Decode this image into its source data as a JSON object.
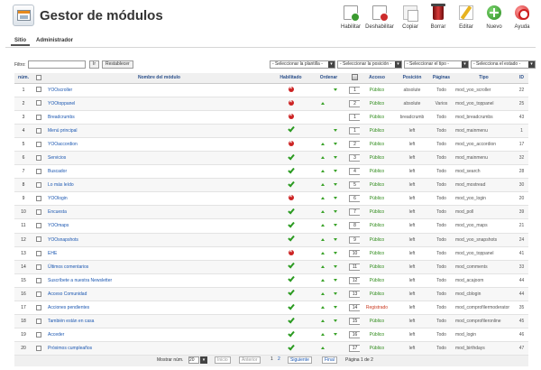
{
  "header": {
    "title": "Gestor de módulos"
  },
  "toolbar": [
    {
      "label": "Habilitar",
      "icon": "enable-icon"
    },
    {
      "label": "Deshabilitar",
      "icon": "disable-icon"
    },
    {
      "label": "Copiar",
      "icon": "copy-icon"
    },
    {
      "label": "Borrar",
      "icon": "trash-icon"
    },
    {
      "label": "Editar",
      "icon": "edit-icon"
    },
    {
      "label": "Nuevo",
      "icon": "new-icon"
    },
    {
      "label": "Ayuda",
      "icon": "help-icon"
    }
  ],
  "submenu": {
    "site": "Sitio",
    "admin": "Administrador"
  },
  "filter": {
    "label": "Filtro:",
    "value": "",
    "go": "Ir",
    "reset": "Restablecer",
    "template": "- Seleccionar la plantilla -",
    "position": "- Seleccionar la posición -",
    "type": "- Seleccionar el tipo -",
    "state": "- Selecciona el estado -"
  },
  "columns": {
    "num": "núm.",
    "name": "Nombre del módulo",
    "enabled": "Habilitado",
    "order": "Ordenar",
    "access": "Acceso",
    "position": "Posición",
    "pages": "Páginas",
    "type": "Tipo",
    "id": "ID"
  },
  "rows": [
    {
      "num": "1",
      "name": "YOOscroller",
      "enabled": false,
      "up": false,
      "down": true,
      "order": "1",
      "access": "Público",
      "position": "absolute",
      "pages": "Todo",
      "type": "mod_yoo_scroller",
      "id": "22"
    },
    {
      "num": "2",
      "name": "YOOtoppanel",
      "enabled": false,
      "up": true,
      "down": false,
      "order": "2",
      "access": "Público",
      "position": "absolute",
      "pages": "Varios",
      "type": "mod_yoo_toppanel",
      "id": "25"
    },
    {
      "num": "3",
      "name": "Breadcrumbs",
      "enabled": false,
      "up": false,
      "down": false,
      "order": "1",
      "access": "Público",
      "position": "breadcrumb",
      "pages": "Todo",
      "type": "mod_breadcrumbs",
      "id": "43"
    },
    {
      "num": "4",
      "name": "Menú principal",
      "enabled": true,
      "up": false,
      "down": true,
      "order": "1",
      "access": "Público",
      "position": "left",
      "pages": "Todo",
      "type": "mod_mainmenu",
      "id": "1"
    },
    {
      "num": "5",
      "name": "YOOaccordion",
      "enabled": false,
      "up": true,
      "down": true,
      "order": "2",
      "access": "Público",
      "position": "left",
      "pages": "Todo",
      "type": "mod_yoo_accordion",
      "id": "17"
    },
    {
      "num": "6",
      "name": "Servicios",
      "enabled": true,
      "up": true,
      "down": true,
      "order": "3",
      "access": "Público",
      "position": "left",
      "pages": "Todo",
      "type": "mod_mainmenu",
      "id": "32"
    },
    {
      "num": "7",
      "name": "Buscador",
      "enabled": true,
      "up": true,
      "down": true,
      "order": "4",
      "access": "Público",
      "position": "left",
      "pages": "Todo",
      "type": "mod_search",
      "id": "28"
    },
    {
      "num": "8",
      "name": "Lo más leído",
      "enabled": true,
      "up": true,
      "down": true,
      "order": "5",
      "access": "Público",
      "position": "left",
      "pages": "Todo",
      "type": "mod_mostread",
      "id": "30"
    },
    {
      "num": "9",
      "name": "YOOlogin",
      "enabled": false,
      "up": true,
      "down": true,
      "order": "6",
      "access": "Público",
      "position": "left",
      "pages": "Todo",
      "type": "mod_yoo_login",
      "id": "20"
    },
    {
      "num": "10",
      "name": "Encuesta",
      "enabled": true,
      "up": true,
      "down": true,
      "order": "7",
      "access": "Público",
      "position": "left",
      "pages": "Todo",
      "type": "mod_poll",
      "id": "39"
    },
    {
      "num": "11",
      "name": "YOOmaps",
      "enabled": true,
      "up": true,
      "down": true,
      "order": "8",
      "access": "Público",
      "position": "left",
      "pages": "Todo",
      "type": "mod_yoo_maps",
      "id": "21"
    },
    {
      "num": "12",
      "name": "YOOsnapshots",
      "enabled": true,
      "up": true,
      "down": true,
      "order": "9",
      "access": "Público",
      "position": "left",
      "pages": "Todo",
      "type": "mod_yoo_snapshots",
      "id": "24"
    },
    {
      "num": "13",
      "name": "EHE",
      "enabled": false,
      "up": true,
      "down": true,
      "order": "10",
      "access": "Público",
      "position": "left",
      "pages": "Todo",
      "type": "mod_yoo_toppanel",
      "id": "41"
    },
    {
      "num": "14",
      "name": "Últimos comentarios",
      "enabled": true,
      "up": true,
      "down": true,
      "order": "11",
      "access": "Público",
      "position": "left",
      "pages": "Todo",
      "type": "mod_comments",
      "id": "33"
    },
    {
      "num": "15",
      "name": "Suscríbete a nuestra Newsletter",
      "enabled": true,
      "up": true,
      "down": true,
      "order": "12",
      "access": "Público",
      "position": "left",
      "pages": "Todo",
      "type": "mod_acajoom",
      "id": "44"
    },
    {
      "num": "16",
      "name": "Acceso Comunidad",
      "enabled": true,
      "up": true,
      "down": true,
      "order": "13",
      "access": "Público",
      "position": "left",
      "pages": "Todo",
      "type": "mod_cblogin",
      "id": "44"
    },
    {
      "num": "17",
      "name": "Acciones pendientes",
      "enabled": true,
      "up": true,
      "down": true,
      "order": "14",
      "access": "Registrado",
      "position": "left",
      "pages": "Todo",
      "type": "mod_comprofilermoderator",
      "id": "35"
    },
    {
      "num": "18",
      "name": "También están en casa",
      "enabled": true,
      "up": true,
      "down": true,
      "order": "15",
      "access": "Público",
      "position": "left",
      "pages": "Todo",
      "type": "mod_comprofileronline",
      "id": "45"
    },
    {
      "num": "19",
      "name": "Acceder",
      "enabled": true,
      "up": true,
      "down": true,
      "order": "16",
      "access": "Público",
      "position": "left",
      "pages": "Todo",
      "type": "mod_login",
      "id": "46"
    },
    {
      "num": "20",
      "name": "Próximos cumpleaños",
      "enabled": true,
      "up": true,
      "down": false,
      "order": "17",
      "access": "Público",
      "position": "left",
      "pages": "Todo",
      "type": "mod_birthdays",
      "id": "47"
    }
  ],
  "footer": {
    "show": "Mostrar núm.",
    "limit": "20",
    "start": "Inicio",
    "prev": "Anterior",
    "page1": "1",
    "page2": "2",
    "next": "Siguiente",
    "end": "Final",
    "page_info": "Página 1 de 2"
  },
  "colors": {
    "link": "#1b57b1",
    "public": "#2d8a19",
    "registered": "#c9381e",
    "header_text": "#2a4f8a"
  }
}
